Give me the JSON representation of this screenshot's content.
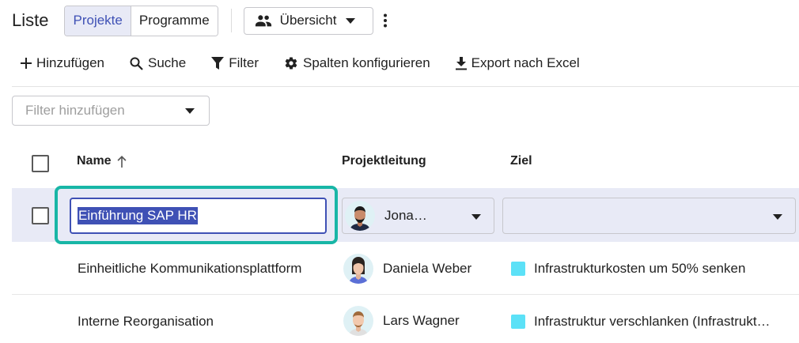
{
  "header": {
    "title": "Liste",
    "tabs": [
      {
        "label": "Projekte",
        "active": true
      },
      {
        "label": "Programme",
        "active": false
      }
    ],
    "view": {
      "label": "Übersicht",
      "icon": "people-icon"
    },
    "more_icon": "more-vert-icon"
  },
  "toolbar": {
    "add": "Hinzufügen",
    "search": "Suche",
    "filter": "Filter",
    "columns": "Spalten konfigurieren",
    "export": "Export nach Excel"
  },
  "filter_select": {
    "placeholder": "Filter hinzufügen"
  },
  "table": {
    "columns": {
      "name": "Name",
      "lead": "Projektleitung",
      "goal": "Ziel"
    },
    "sort": {
      "column": "name",
      "direction": "asc"
    },
    "rows": [
      {
        "name": "Einführung SAP HR",
        "lead": "Jona…",
        "goal": "",
        "editing": true,
        "selected": false
      },
      {
        "name": "Einheitliche Kommunikationsplattform",
        "lead": "Daniela Weber",
        "goal": "Infrastrukturkosten um 50% senken"
      },
      {
        "name": "Interne Reorganisation",
        "lead": "Lars Wagner",
        "goal": "Infrastruktur verschlanken (Infrastrukt…"
      }
    ]
  },
  "colors": {
    "accent": "#3f51b5",
    "selected_row": "#e8eaf6",
    "focus_ring": "#18b6a6",
    "goal_marker": "#5ce1f7"
  }
}
